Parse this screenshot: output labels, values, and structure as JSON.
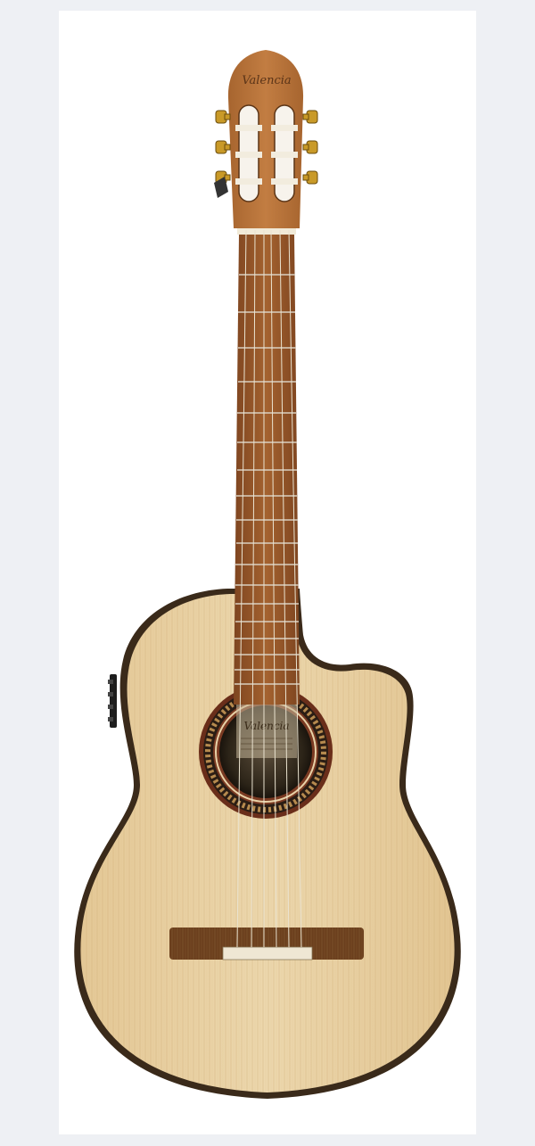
{
  "photo": {
    "subject": "acoustic-electric classical guitar with cutaway",
    "headstock_logo_text": "Valencia",
    "soundhole_label_text": "Valencia",
    "colors": {
      "page_background": "#eef0f4",
      "frame_background": "#ffffff",
      "top_wood": "#e7cfa0",
      "neck_wood": "#9a5a2c",
      "headstock_wood": "#b57136",
      "bridge_wood": "#6b3f1d",
      "binding": "#3a2a1a",
      "tuner_gold": "#c99a28"
    }
  }
}
